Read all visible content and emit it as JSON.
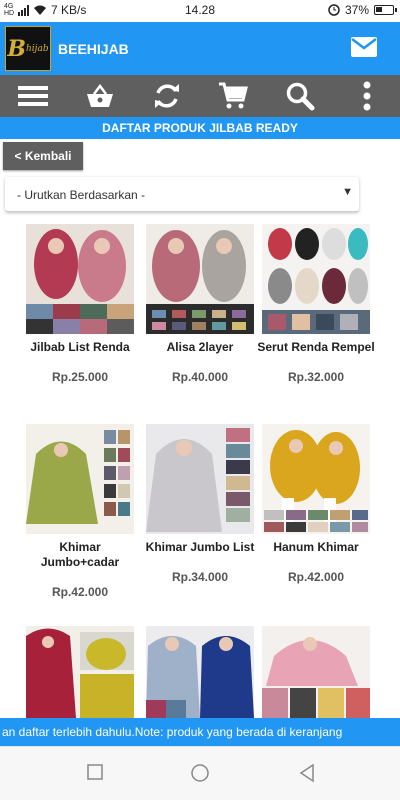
{
  "status_bar": {
    "network": "4G HD",
    "speed": "7 KB/s",
    "time": "14.28",
    "battery": "37%"
  },
  "header": {
    "logo_letter": "B",
    "logo_text": "hijab",
    "title": "BEEHIJAB",
    "mail_icon": "envelope-icon"
  },
  "toolbar": {
    "items": [
      "menu-icon",
      "basket-icon",
      "refresh-icon",
      "cart-icon",
      "search-icon",
      "more-vertical-icon"
    ]
  },
  "banner": "DAFTAR PRODUK JILBAB READY",
  "back_label": "< Kembali",
  "sort": {
    "selected": "- Urutkan Berdasarkan -",
    "arrow": "▼"
  },
  "products": [
    {
      "name": "Jilbab List Renda",
      "price": "Rp.25.000"
    },
    {
      "name": "Alisa 2layer",
      "price": "Rp.40.000"
    },
    {
      "name": "Serut Renda Rempel",
      "price": "Rp.32.000"
    },
    {
      "name": "Khimar Jumbo+cadar",
      "price": "Rp.42.000"
    },
    {
      "name": "Khimar Jumbo List",
      "price": "Rp.34.000"
    },
    {
      "name": "Hanum Khimar",
      "price": "Rp.42.000"
    },
    {
      "name": "",
      "price": ""
    },
    {
      "name": "",
      "price": ""
    },
    {
      "name": "",
      "price": ""
    }
  ],
  "marquee": "an daftar terlebih dahulu.Note: produk yang berada di keranjang",
  "colors": {
    "primary": "#2196f3",
    "toolbar": "#5f5f5f"
  }
}
